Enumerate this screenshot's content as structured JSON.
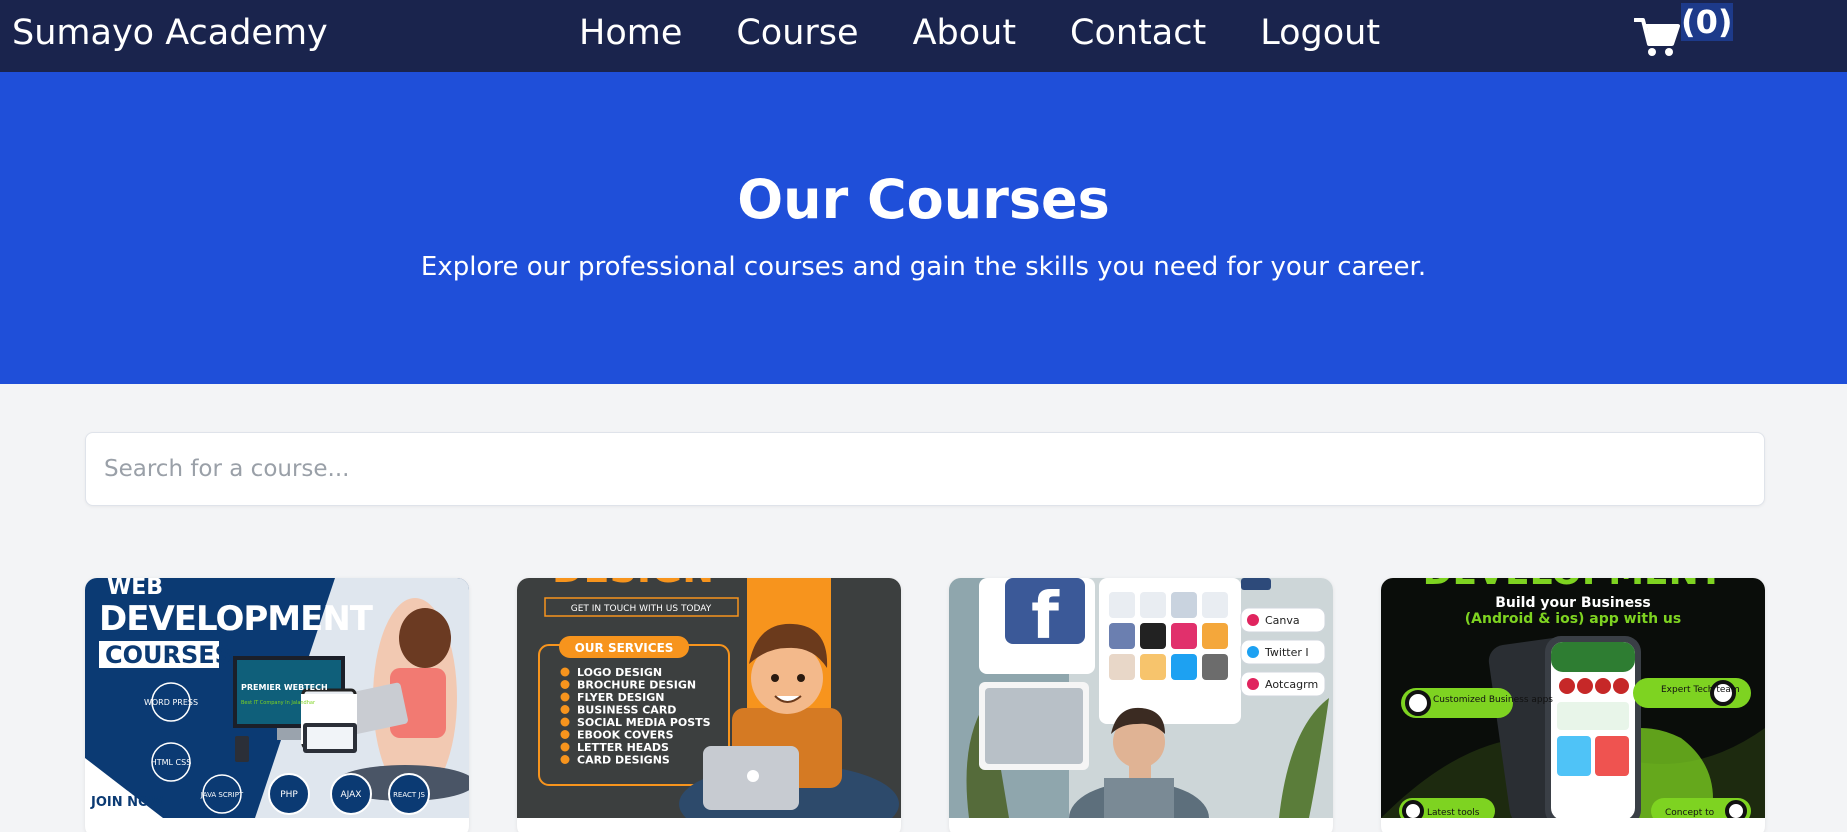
{
  "navbar": {
    "brand": "Sumayo Academy",
    "links": [
      "Home",
      "Course",
      "About",
      "Contact",
      "Logout"
    ],
    "cart_icon": "shopping-cart-icon",
    "cart_count": "(0)"
  },
  "hero": {
    "title": "Our Courses",
    "subtitle": "Explore our professional courses and gain the skills you need for your career."
  },
  "search": {
    "placeholder": "Search for a course...",
    "value": ""
  },
  "courses": [
    {
      "image_text": {
        "line1": "WEB",
        "line2": "DEVELOPMENT",
        "line3": "COURSES",
        "brand": "PREMIER WEBTECH",
        "tagline": "Best IT Company In Jalandhar",
        "join": "JOIN NOW",
        "badges": [
          "WORD PRESS",
          "HTML CSS",
          "JAVA SCRIPT",
          "PHP",
          "AJAX",
          "REACT JS"
        ]
      }
    },
    {
      "image_text": {
        "header": "DESIGN",
        "contact": "GET IN TOUCH WITH US TODAY",
        "services_title": "OUR SERVICES",
        "services": [
          "LOGO DESIGN",
          "BROCHURE DESIGN",
          "FLYER DESIGN",
          "BUSINESS CARD",
          "SOCIAL MEDIA POSTS",
          "EBOOK COVERS",
          "LETTER HEADS",
          "CARD DESIGNS"
        ]
      }
    },
    {
      "image_text": {
        "apps": [
          "Canva",
          "Twitter I",
          "Aotcagrm"
        ]
      }
    },
    {
      "image_text": {
        "header": "DEVELOPMENT",
        "line1": "Build your Business",
        "line2": "(Android & ios) app with us",
        "feature_left": "Customized Business apps",
        "feature_right": "Expert Tech team",
        "bottom_left": "Latest tools",
        "bottom_right": "Concept to"
      }
    }
  ],
  "colors": {
    "navbar": "#1a244d",
    "hero": "#1f4fd9",
    "page_bg": "#f3f4f6",
    "accent_orange": "#f7941d",
    "accent_green": "#7ed321"
  }
}
